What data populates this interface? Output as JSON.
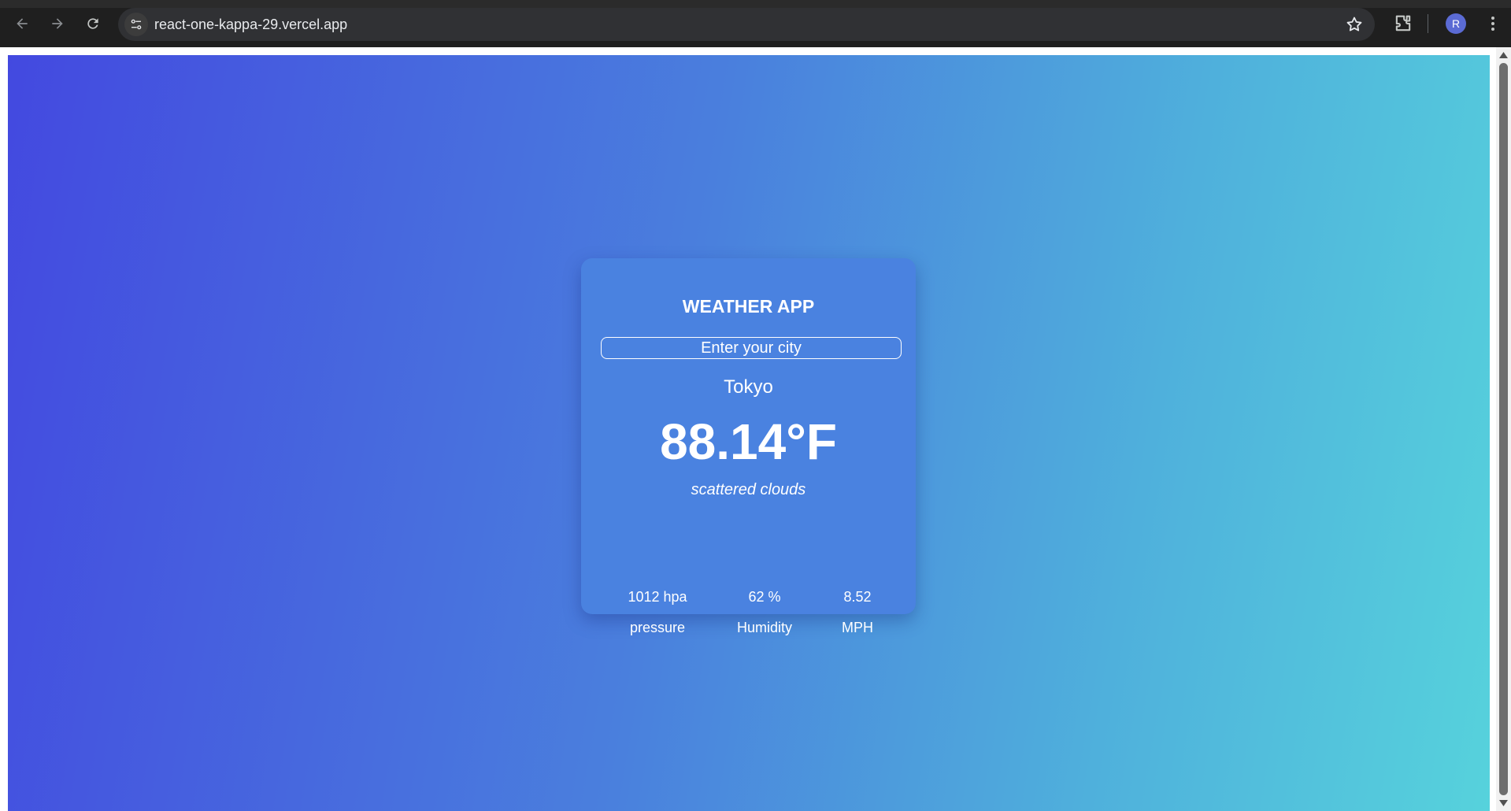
{
  "browser": {
    "url": "react-one-kappa-29.vercel.app",
    "profile_initial": "R",
    "icons": [
      "back-icon",
      "forward-icon",
      "reload-icon",
      "site-info-icon",
      "bookmark-star-icon",
      "extensions-icon",
      "menu-dots-icon"
    ]
  },
  "app": {
    "title": "WEATHER APP",
    "search": {
      "placeholder": "Enter your city",
      "value": ""
    },
    "city": "Tokyo",
    "temperature": "88.14°F",
    "description": "scattered clouds",
    "stats": [
      {
        "value": "1012 hpa",
        "label": "pressure"
      },
      {
        "value": "62 %",
        "label": "Humidity"
      },
      {
        "value": "8.52",
        "label": "MPH"
      }
    ]
  },
  "colors": {
    "gradient_start": "#4349e0",
    "gradient_end": "#56d2dc",
    "card": "#4a82e0",
    "text": "#ffffff"
  }
}
